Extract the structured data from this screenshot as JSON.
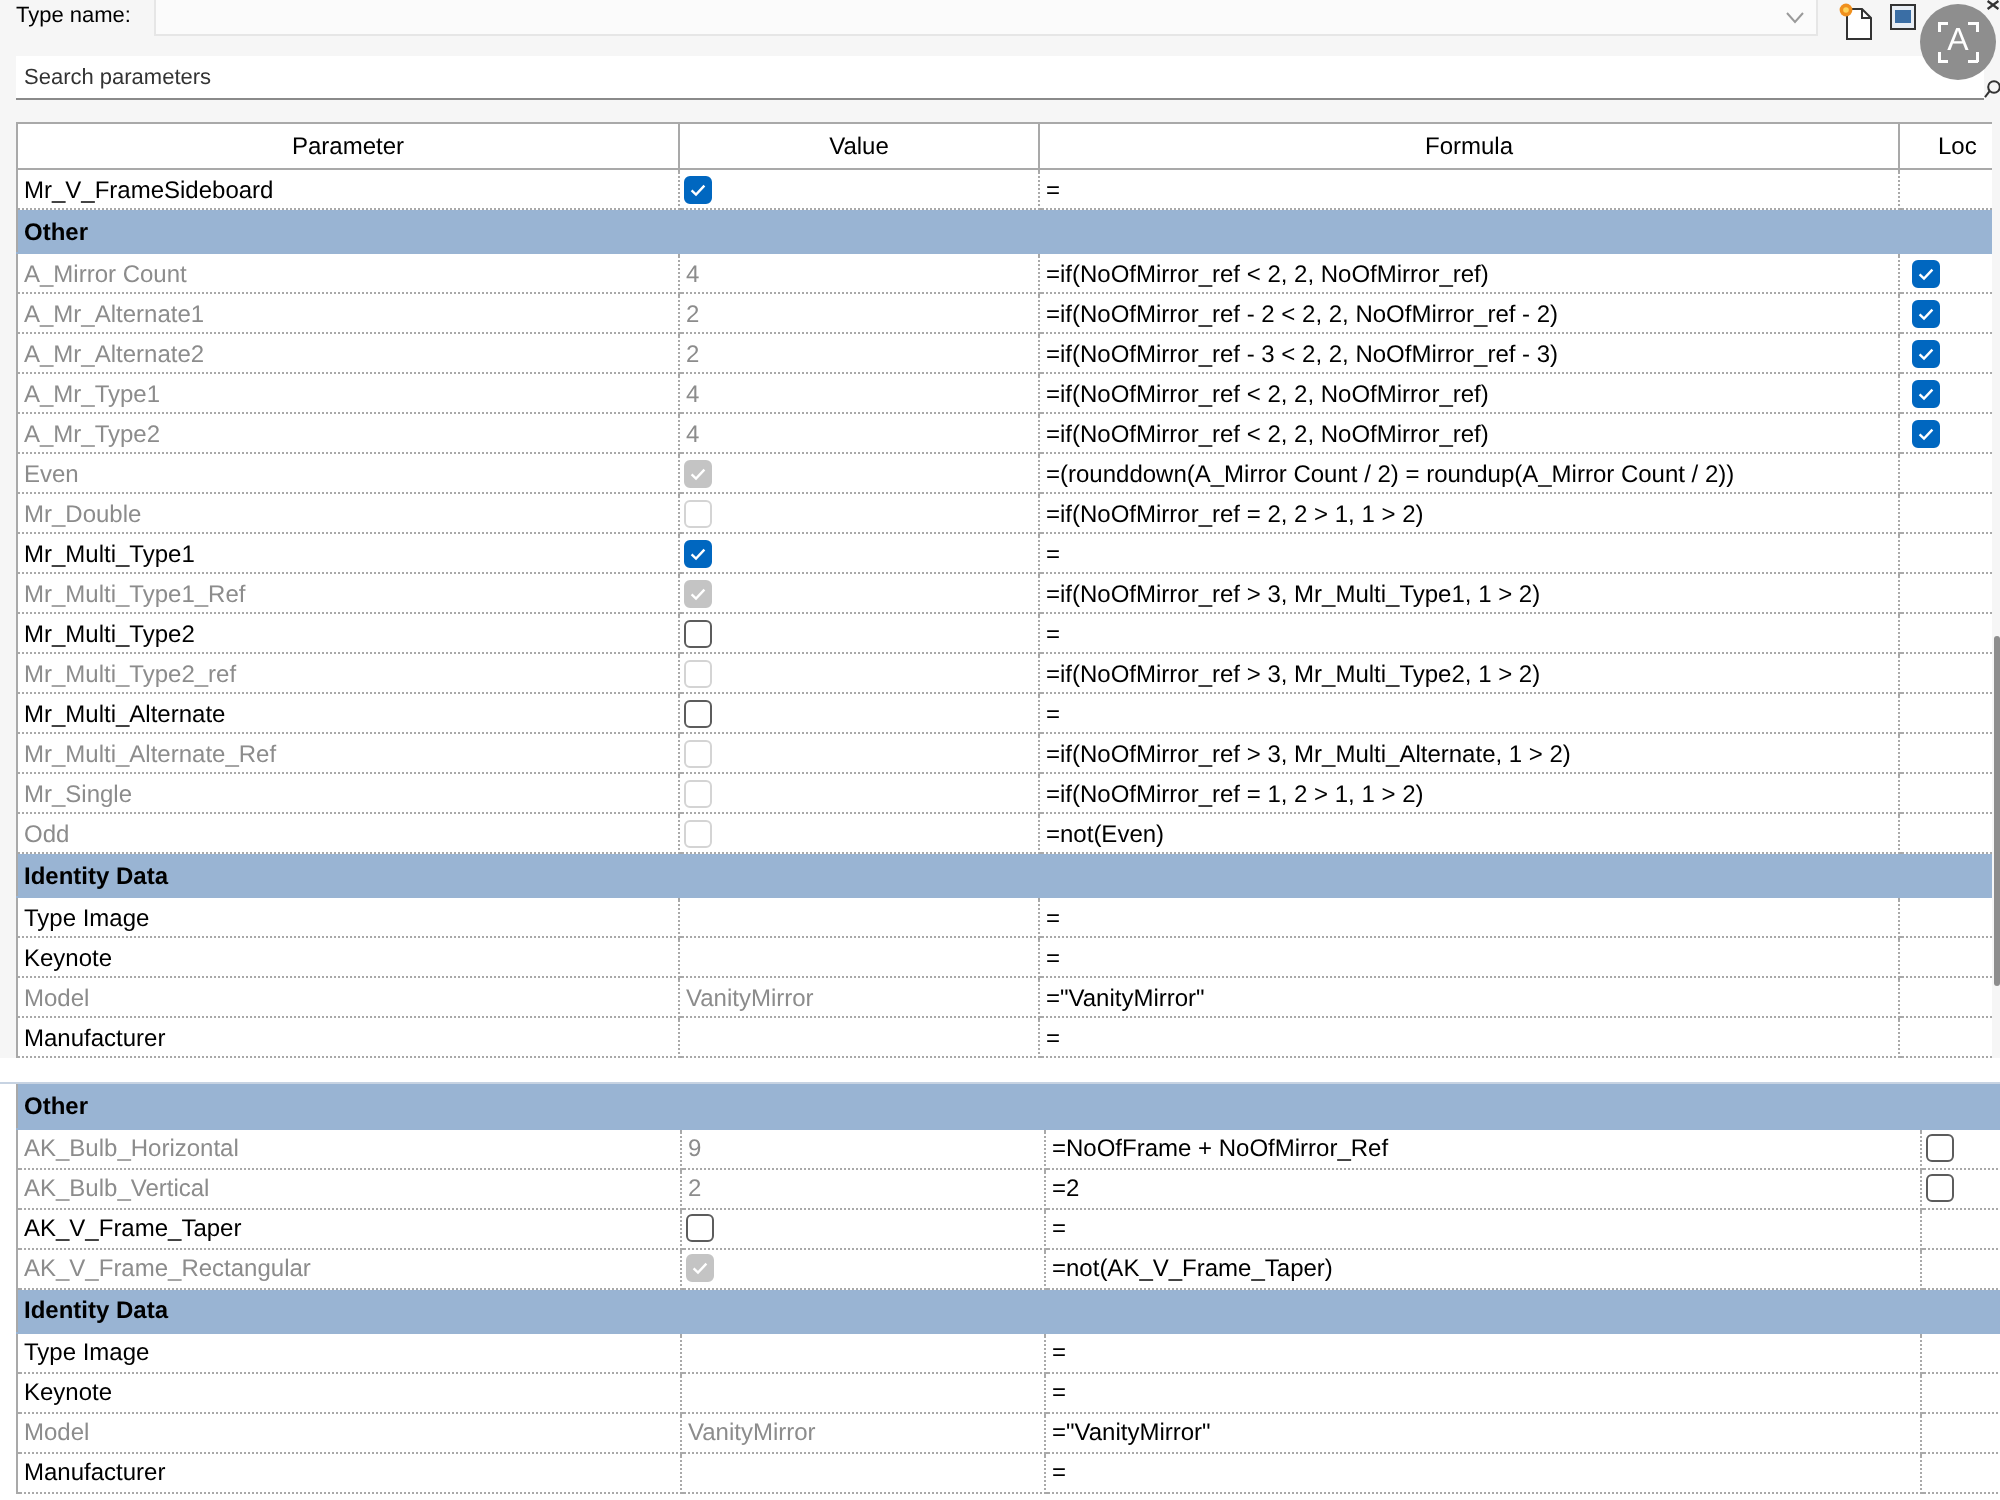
{
  "type_name": {
    "label": "Type name:"
  },
  "search": {
    "placeholder": "Search parameters"
  },
  "table": {
    "columns": [
      "Parameter",
      "Value",
      "Formula",
      "Loc"
    ],
    "rows": [
      {
        "kind": "param",
        "parameter": "Mr_V_FrameSideboard",
        "disabled": false,
        "value": {
          "kind": "checkbox",
          "checked": true
        },
        "formula": "="
      },
      {
        "kind": "group",
        "title": "Other"
      },
      {
        "kind": "param",
        "parameter": "A_Mirror Count",
        "disabled": true,
        "value": {
          "kind": "text",
          "text": "4"
        },
        "formula": "=if(NoOfMirror_ref < 2, 2, NoOfMirror_ref)",
        "lock": {
          "checked": true
        }
      },
      {
        "kind": "param",
        "parameter": "A_Mr_Alternate1",
        "disabled": true,
        "value": {
          "kind": "text",
          "text": "2"
        },
        "formula": "=if(NoOfMirror_ref - 2 < 2, 2, NoOfMirror_ref - 2)",
        "lock": {
          "checked": true
        }
      },
      {
        "kind": "param",
        "parameter": "A_Mr_Alternate2",
        "disabled": true,
        "value": {
          "kind": "text",
          "text": "2"
        },
        "formula": "=if(NoOfMirror_ref - 3 < 2, 2, NoOfMirror_ref - 3)",
        "lock": {
          "checked": true
        }
      },
      {
        "kind": "param",
        "parameter": "A_Mr_Type1",
        "disabled": true,
        "value": {
          "kind": "text",
          "text": "4"
        },
        "formula": "=if(NoOfMirror_ref < 2, 2, NoOfMirror_ref)",
        "lock": {
          "checked": true
        }
      },
      {
        "kind": "param",
        "parameter": "A_Mr_Type2",
        "disabled": true,
        "value": {
          "kind": "text",
          "text": "4"
        },
        "formula": "=if(NoOfMirror_ref < 2, 2, NoOfMirror_ref)",
        "lock": {
          "checked": true
        }
      },
      {
        "kind": "param",
        "parameter": "Even",
        "disabled": true,
        "value": {
          "kind": "checkbox",
          "checked": true
        },
        "formula": "=(rounddown(A_Mirror Count / 2) = roundup(A_Mirror Count / 2))"
      },
      {
        "kind": "param",
        "parameter": "Mr_Double",
        "disabled": true,
        "value": {
          "kind": "checkbox",
          "checked": false
        },
        "formula": "=if(NoOfMirror_ref = 2, 2 > 1, 1 > 2)"
      },
      {
        "kind": "param",
        "parameter": "Mr_Multi_Type1",
        "disabled": false,
        "value": {
          "kind": "checkbox",
          "checked": true
        },
        "formula": "="
      },
      {
        "kind": "param",
        "parameter": "Mr_Multi_Type1_Ref",
        "disabled": true,
        "value": {
          "kind": "checkbox",
          "checked": true
        },
        "formula": "=if(NoOfMirror_ref > 3, Mr_Multi_Type1, 1 > 2)"
      },
      {
        "kind": "param",
        "parameter": "Mr_Multi_Type2",
        "disabled": false,
        "value": {
          "kind": "checkbox",
          "checked": false
        },
        "formula": "="
      },
      {
        "kind": "param",
        "parameter": "Mr_Multi_Type2_ref",
        "disabled": true,
        "value": {
          "kind": "checkbox",
          "checked": false
        },
        "formula": "=if(NoOfMirror_ref > 3, Mr_Multi_Type2, 1 > 2)"
      },
      {
        "kind": "param",
        "parameter": "Mr_Multi_Alternate",
        "disabled": false,
        "value": {
          "kind": "checkbox",
          "checked": false
        },
        "formula": "="
      },
      {
        "kind": "param",
        "parameter": "Mr_Multi_Alternate_Ref",
        "disabled": true,
        "value": {
          "kind": "checkbox",
          "checked": false
        },
        "formula": "=if(NoOfMirror_ref > 3, Mr_Multi_Alternate, 1 > 2)"
      },
      {
        "kind": "param",
        "parameter": "Mr_Single",
        "disabled": true,
        "value": {
          "kind": "checkbox",
          "checked": false
        },
        "formula": "=if(NoOfMirror_ref = 1, 2 > 1, 1 > 2)"
      },
      {
        "kind": "param",
        "parameter": "Odd",
        "disabled": true,
        "value": {
          "kind": "checkbox",
          "checked": false
        },
        "formula": "=not(Even)"
      },
      {
        "kind": "group",
        "title": "Identity Data"
      },
      {
        "kind": "param",
        "parameter": "Type Image",
        "disabled": false,
        "formula": "="
      },
      {
        "kind": "param",
        "parameter": "Keynote",
        "disabled": false,
        "formula": "="
      },
      {
        "kind": "param",
        "parameter": "Model",
        "disabled": true,
        "value": {
          "kind": "text",
          "text": "VanityMirror"
        },
        "formula": "=\"VanityMirror\""
      },
      {
        "kind": "param",
        "parameter": "Manufacturer",
        "disabled": false,
        "formula": "="
      }
    ]
  },
  "second_table": {
    "rows": [
      {
        "kind": "group",
        "title": "Other"
      },
      {
        "kind": "param",
        "parameter": "AK_Bulb_Horizontal",
        "disabled": true,
        "value": {
          "kind": "text",
          "text": "9"
        },
        "formula": "=NoOfFrame + NoOfMirror_Ref",
        "lock": {
          "checked": false
        }
      },
      {
        "kind": "param",
        "parameter": "AK_Bulb_Vertical",
        "disabled": true,
        "value": {
          "kind": "text",
          "text": "2"
        },
        "formula": "=2",
        "lock": {
          "checked": false
        }
      },
      {
        "kind": "param",
        "parameter": "AK_V_Frame_Taper",
        "disabled": false,
        "value": {
          "kind": "checkbox",
          "checked": false
        },
        "formula": "="
      },
      {
        "kind": "param",
        "parameter": "AK_V_Frame_Rectangular",
        "disabled": true,
        "value": {
          "kind": "checkbox",
          "checked": true
        },
        "formula": "=not(AK_V_Frame_Taper)"
      },
      {
        "kind": "group",
        "title": "Identity Data"
      },
      {
        "kind": "param",
        "parameter": "Type Image",
        "disabled": false,
        "formula": "="
      },
      {
        "kind": "param",
        "parameter": "Keynote",
        "disabled": false,
        "formula": "="
      },
      {
        "kind": "param",
        "parameter": "Model",
        "disabled": true,
        "value": {
          "kind": "text",
          "text": "VanityMirror"
        },
        "formula": "=\"VanityMirror\""
      },
      {
        "kind": "param",
        "parameter": "Manufacturer",
        "disabled": false,
        "formula": "="
      }
    ]
  },
  "overlay_button": {
    "glyph": "A"
  }
}
